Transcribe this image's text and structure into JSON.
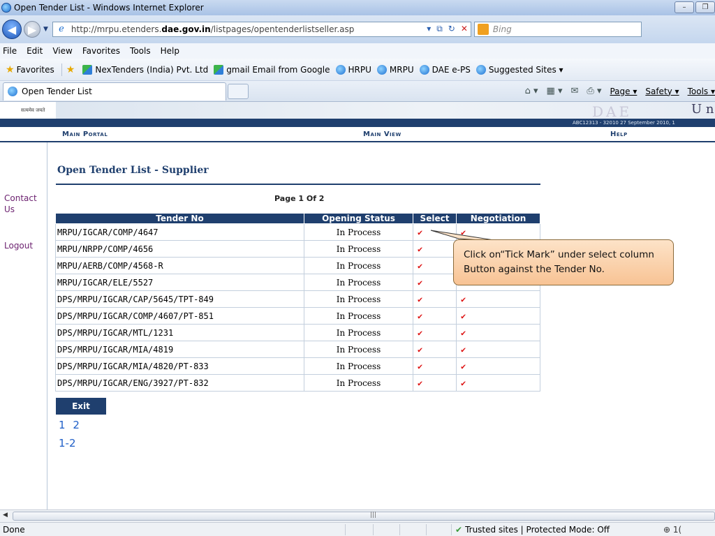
{
  "window": {
    "title": "Open Tender List - Windows Internet Explorer",
    "minimize": "–",
    "restore": "❐"
  },
  "address": {
    "url_prefix": "http://mrpu.etenders.",
    "url_domain": "dae.gov.in",
    "url_suffix": "/listpages/opentenderlistseller.asp",
    "search_placeholder": "Bing"
  },
  "menu": [
    "File",
    "Edit",
    "View",
    "Favorites",
    "Tools",
    "Help"
  ],
  "favorites": {
    "label": "Favorites",
    "items": [
      "NexTenders (India) Pvt. Ltd",
      "gmail Email from Google",
      "HRPU",
      "MRPU",
      "DAE e-PS",
      "Suggested Sites ▾"
    ]
  },
  "tab": {
    "label": "Open Tender List"
  },
  "commands": {
    "page": "Page ▾",
    "safety": "Safety ▾",
    "tools": "Tools ▾"
  },
  "site": {
    "hindi_text": "सत्यमेव जयते",
    "dae_logo": "DAE",
    "right_partial": "U n",
    "info": "ABC12313 - 32010    27 September 2010,  1",
    "nav": [
      "Main Portal",
      "Main View",
      "Help"
    ]
  },
  "sidebar": [
    "Contact Us",
    "Logout"
  ],
  "content": {
    "heading": "Open Tender List - Supplier",
    "page_info": "Page 1 Of 2",
    "columns": [
      "Tender No",
      "Opening Status",
      "Select",
      "Negotiation"
    ],
    "rows": [
      {
        "tender": "MRPU/IGCAR/COMP/4647",
        "status": "In Process",
        "select": "✔",
        "negotiation": "✔"
      },
      {
        "tender": "MRPU/NRPP/COMP/4656",
        "status": "In Process",
        "select": "✔",
        "negotiation": "✔"
      },
      {
        "tender": "MRPU/AERB/COMP/4568-R",
        "status": "In Process",
        "select": "✔",
        "negotiation": "✔"
      },
      {
        "tender": "MRPU/IGCAR/ELE/5527",
        "status": "In Process",
        "select": "✔",
        "negotiation": "✔"
      },
      {
        "tender": "DPS/MRPU/IGCAR/CAP/5645/TPT-849",
        "status": "In Process",
        "select": "✔",
        "negotiation": "✔"
      },
      {
        "tender": "DPS/MRPU/IGCAR/COMP/4607/PT-851",
        "status": "In Process",
        "select": "✔",
        "negotiation": "✔"
      },
      {
        "tender": "DPS/MRPU/IGCAR/MTL/1231",
        "status": "In Process",
        "select": "✔",
        "negotiation": "✔"
      },
      {
        "tender": "DPS/MRPU/IGCAR/MIA/4819",
        "status": "In Process",
        "select": "✔",
        "negotiation": "✔"
      },
      {
        "tender": "DPS/MRPU/IGCAR/MIA/4820/PT-833",
        "status": "In Process",
        "select": "✔",
        "negotiation": "✔"
      },
      {
        "tender": "DPS/MRPU/IGCAR/ENG/3927/PT-832",
        "status": "In Process",
        "select": "✔",
        "negotiation": "✔"
      }
    ],
    "exit_label": "Exit",
    "pages": [
      "1",
      "2"
    ],
    "range": "1-2"
  },
  "callout": {
    "line1": "Click on“Tick Mark” under select column",
    "line2": "Button against the Tender No."
  },
  "status": {
    "text": "Done",
    "zone": "Trusted sites | Protected Mode: Off",
    "zoom": "⊕ 1("
  }
}
